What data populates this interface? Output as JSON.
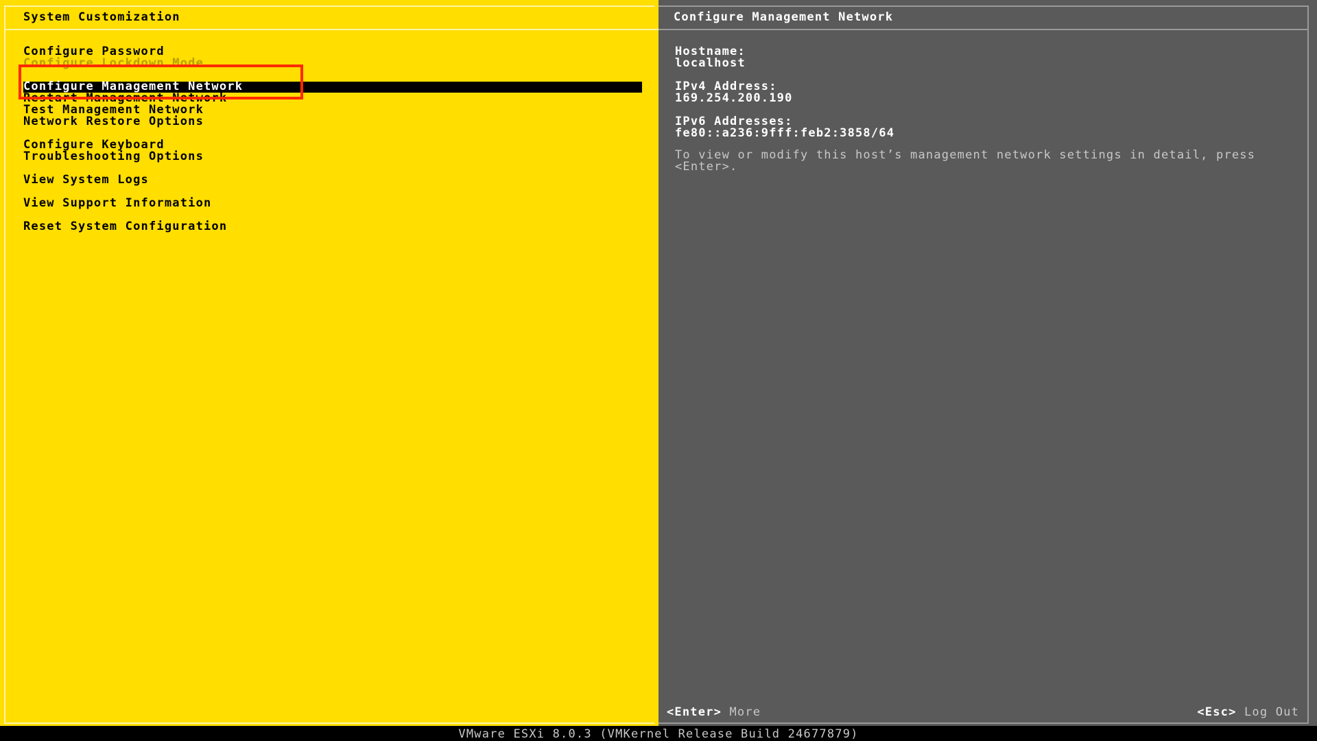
{
  "left_panel": {
    "title": "System Customization",
    "menu": [
      {
        "label": "Configure Password",
        "state": "normal"
      },
      {
        "label": "Configure Lockdown Mode",
        "state": "disabled"
      },
      {
        "label": "Configure Management Network",
        "state": "selected"
      },
      {
        "label": "Restart Management Network",
        "state": "normal"
      },
      {
        "label": "Test Management Network",
        "state": "normal"
      },
      {
        "label": "Network Restore Options",
        "state": "normal"
      },
      {
        "label": "Configure Keyboard",
        "state": "normal"
      },
      {
        "label": "Troubleshooting Options",
        "state": "normal"
      },
      {
        "label": "View System Logs",
        "state": "normal"
      },
      {
        "label": "View Support Information",
        "state": "normal"
      },
      {
        "label": "Reset System Configuration",
        "state": "normal"
      }
    ]
  },
  "right_panel": {
    "title": "Configure Management Network",
    "hostname_label": "Hostname:",
    "hostname_value": "localhost",
    "ipv4_label": "IPv4 Address:",
    "ipv4_value": "169.254.200.190",
    "ipv6_label": "IPv6 Addresses:",
    "ipv6_value": "fe80::a236:9fff:feb2:3858/64",
    "hint": "To view or modify this host’s management network settings in detail, press <Enter>."
  },
  "footer": {
    "enter_key": "<Enter>",
    "enter_action": "More",
    "esc_key": "<Esc>",
    "esc_action": "Log Out"
  },
  "status_bar": {
    "text": "VMware ESXi 8.0.3 (VMKernel Release Build 24677879)"
  },
  "colors": {
    "left_bg": "#ffde00",
    "right_bg": "#5a5a5a",
    "selection_bg": "#000000",
    "annotation": "#ff2a00"
  }
}
